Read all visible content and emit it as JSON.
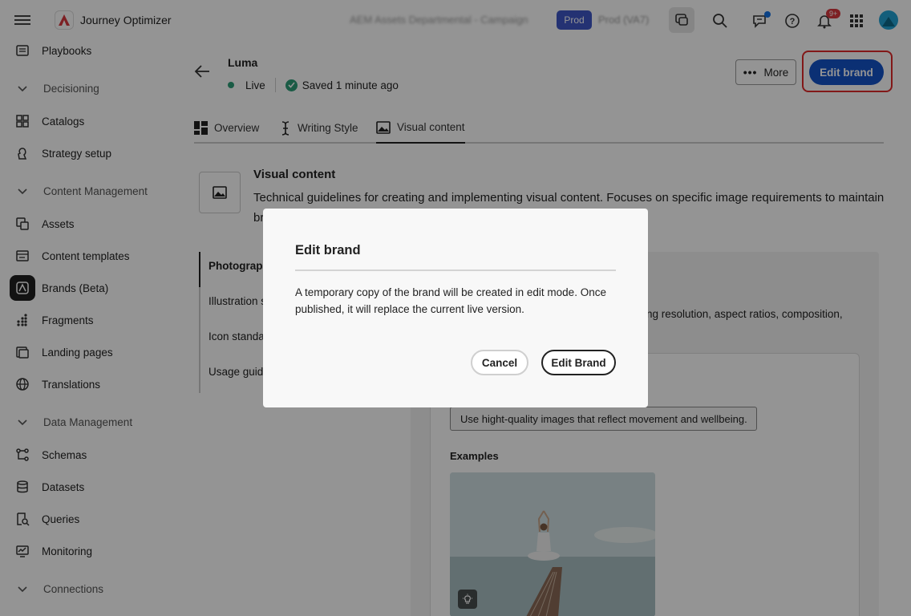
{
  "header": {
    "app_title": "Journey Optimizer",
    "sandbox_name": "AEM Assets Departmental - Campaign",
    "env_badge": "Prod",
    "env_name": "Prod (VA7)",
    "notification_count": "9+"
  },
  "sidebar": {
    "items": [
      {
        "label": "Playbooks",
        "icon": "playbooks-icon"
      },
      {
        "label": "Decisioning",
        "type": "section"
      },
      {
        "label": "Catalogs",
        "icon": "catalogs-icon"
      },
      {
        "label": "Strategy setup",
        "icon": "strategy-icon"
      },
      {
        "label": "Content Management",
        "type": "section"
      },
      {
        "label": "Assets",
        "icon": "assets-icon"
      },
      {
        "label": "Content templates",
        "icon": "templates-icon"
      },
      {
        "label": "Brands (Beta)",
        "icon": "brands-icon",
        "active": true
      },
      {
        "label": "Fragments",
        "icon": "fragments-icon"
      },
      {
        "label": "Landing pages",
        "icon": "landing-pages-icon"
      },
      {
        "label": "Translations",
        "icon": "globe-icon"
      },
      {
        "label": "Data Management",
        "type": "section"
      },
      {
        "label": "Schemas",
        "icon": "schemas-icon"
      },
      {
        "label": "Datasets",
        "icon": "datasets-icon"
      },
      {
        "label": "Queries",
        "icon": "queries-icon"
      },
      {
        "label": "Monitoring",
        "icon": "monitoring-icon"
      },
      {
        "label": "Connections",
        "type": "section"
      }
    ]
  },
  "brand": {
    "name": "Luma",
    "status": "Live",
    "saved": "Saved 1 minute ago",
    "more_label": "More",
    "edit_label": "Edit brand"
  },
  "tabs": [
    {
      "label": "Overview"
    },
    {
      "label": "Writing Style"
    },
    {
      "label": "Visual content",
      "active": true
    }
  ],
  "visual_content": {
    "title": "Visual content",
    "description": "Technical guidelines for creating and implementing visual content. Focuses on specific image requirements to maintain br",
    "subnav": [
      "Photography",
      "Illustration s",
      "Icon standar",
      "Usage guide"
    ],
    "panel_text": "ng resolution, aspect ratios, composition,",
    "guideline": "Use hight-quality images that reflect movement and wellbeing.",
    "examples_label": "Examples"
  },
  "dialog": {
    "title": "Edit brand",
    "body": "A temporary copy of the brand will be created in edit mode. Once published, it will replace the current live version.",
    "cancel_label": "Cancel",
    "confirm_label": "Edit Brand"
  },
  "colors": {
    "accent": "#1354c8",
    "live": "#2d9d78",
    "highlight": "#e02a2a",
    "prod_badge": "#3f56c7"
  }
}
